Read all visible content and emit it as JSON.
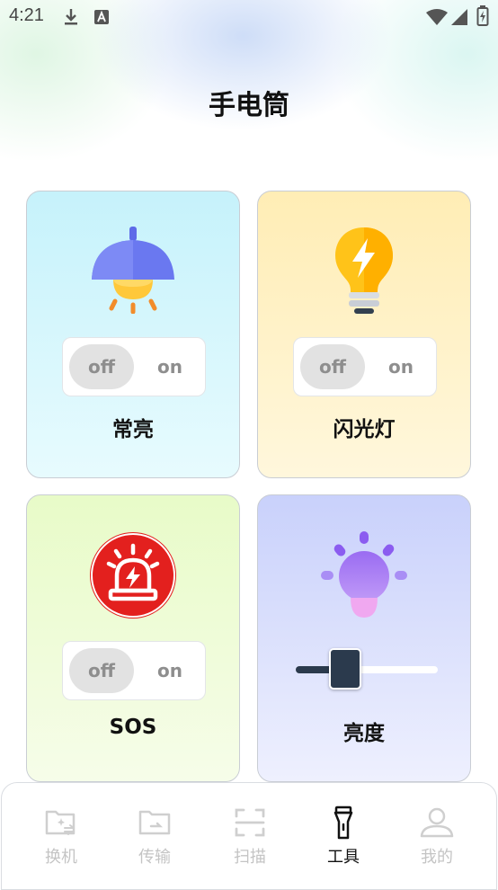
{
  "status_bar": {
    "time": "4:21",
    "icons": [
      "download-icon",
      "a-box-icon",
      "wifi-icon",
      "signal-icon",
      "battery-icon"
    ]
  },
  "header": {
    "title": "手电筒"
  },
  "cards": {
    "steady": {
      "label": "常亮",
      "icon": "pendant-lamp-icon",
      "toggle": {
        "off_label": "off",
        "on_label": "on",
        "state": "off"
      }
    },
    "flash": {
      "label": "闪光灯",
      "icon": "lightning-bulb-icon",
      "toggle": {
        "off_label": "off",
        "on_label": "on",
        "state": "off"
      }
    },
    "sos": {
      "label": "SOS",
      "icon": "alarm-siren-icon",
      "toggle": {
        "off_label": "off",
        "on_label": "on",
        "state": "off"
      }
    },
    "brightness": {
      "label": "亮度",
      "icon": "glowing-bulb-icon",
      "level": 0.35
    }
  },
  "bottom_nav": {
    "items": [
      {
        "label": "换机",
        "icon": "phone-switch-icon",
        "active": false
      },
      {
        "label": "传输",
        "icon": "folder-transfer-icon",
        "active": false
      },
      {
        "label": "扫描",
        "icon": "scan-icon",
        "active": false
      },
      {
        "label": "工具",
        "icon": "flashlight-icon",
        "active": true
      },
      {
        "label": "我的",
        "icon": "user-icon",
        "active": false
      }
    ]
  },
  "colors": {
    "accent_dark": "#2b3a4d",
    "card_blue": "#c6f2fb",
    "card_yellow": "#ffedb5",
    "card_green": "#e8fbc8",
    "card_purple": "#c9d1fb",
    "sos_red": "#e3201e"
  }
}
